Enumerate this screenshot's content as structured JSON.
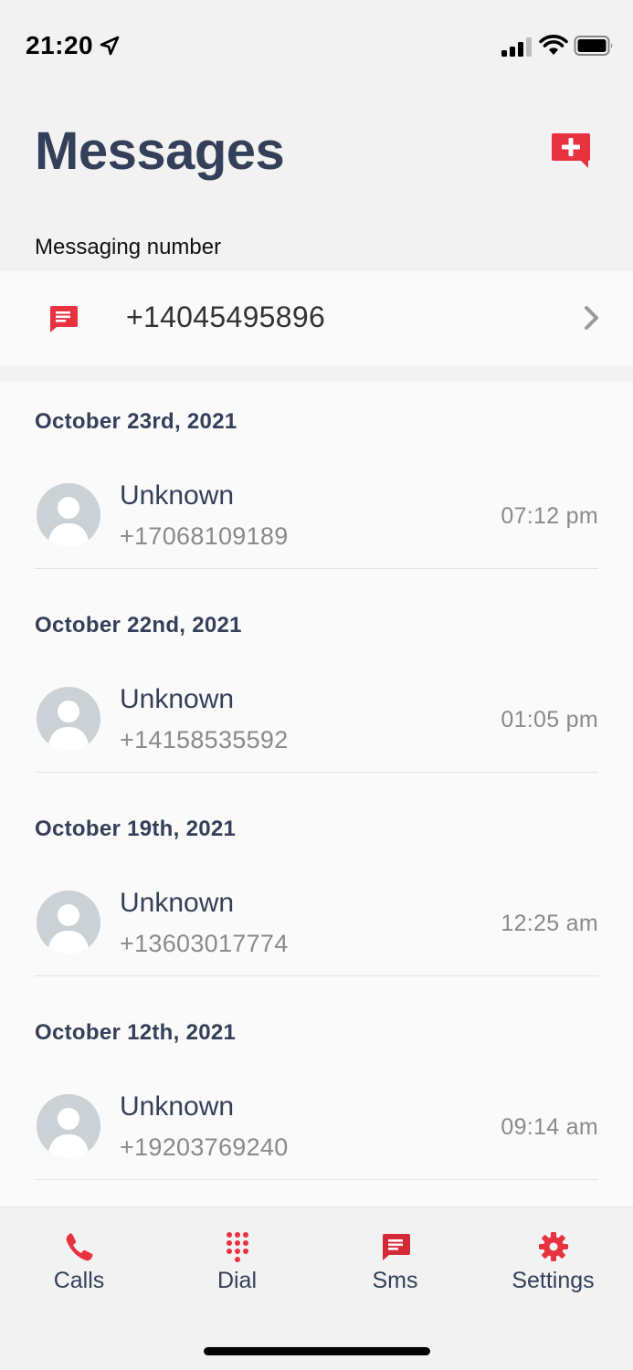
{
  "status_bar": {
    "time": "21:20"
  },
  "header": {
    "title": "Messages"
  },
  "messaging_number": {
    "label": "Messaging number",
    "number": "+14045495896"
  },
  "groups": [
    {
      "date": "October 23rd, 2021",
      "name": "Unknown",
      "number": "+17068109189",
      "time": "07:12 pm"
    },
    {
      "date": "October 22nd, 2021",
      "name": "Unknown",
      "number": "+14158535592",
      "time": "01:05 pm"
    },
    {
      "date": "October 19th, 2021",
      "name": "Unknown",
      "number": "+13603017774",
      "time": "12:25 am"
    },
    {
      "date": "October 12th, 2021",
      "name": "Unknown",
      "number": "+19203769240",
      "time": "09:14 am"
    }
  ],
  "tabs": [
    {
      "label": "Calls",
      "icon": "phone-icon"
    },
    {
      "label": "Dial",
      "icon": "dialpad-icon"
    },
    {
      "label": "Sms",
      "icon": "sms-icon"
    },
    {
      "label": "Settings",
      "icon": "gear-icon"
    }
  ],
  "colors": {
    "accent": "#e8323f",
    "title": "#34405a",
    "muted": "#8a8a8a"
  }
}
